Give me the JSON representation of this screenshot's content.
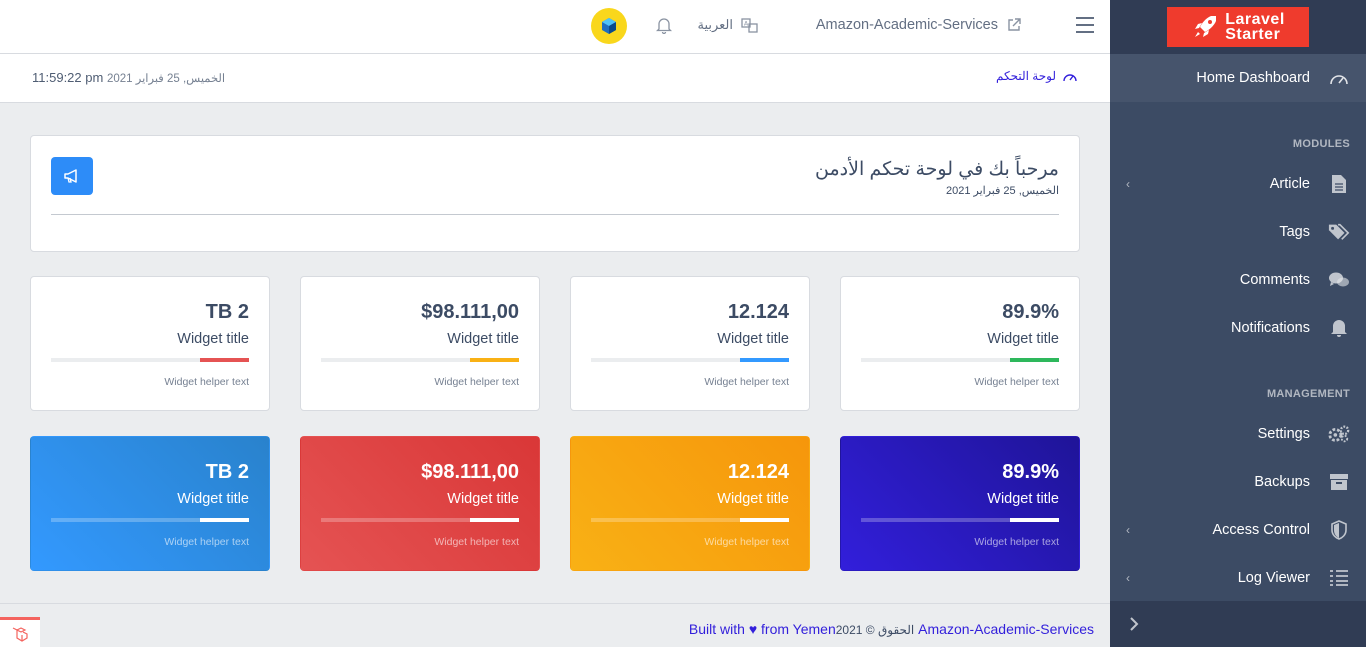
{
  "sidebar": {
    "brand": {
      "line1": "Laravel",
      "line2": "Starter"
    },
    "items": [
      {
        "label": "Home Dashboard",
        "icon": "speedometer-icon",
        "active": true
      },
      {
        "section": "MODULES"
      },
      {
        "label": "Article",
        "icon": "file-icon",
        "has_children": true
      },
      {
        "label": "Tags",
        "icon": "tags-icon"
      },
      {
        "label": "Comments",
        "icon": "comments-icon"
      },
      {
        "label": "Notifications",
        "icon": "bell-icon"
      },
      {
        "section": "MANAGEMENT"
      },
      {
        "label": "Settings",
        "icon": "gears-icon"
      },
      {
        "label": "Backups",
        "icon": "archive-icon"
      },
      {
        "label": "Access Control",
        "icon": "shield-icon",
        "has_children": true
      },
      {
        "label": "Log Viewer",
        "icon": "list-icon",
        "has_children": true
      }
    ],
    "modules_label": "MODULES",
    "management_label": "MANAGEMENT",
    "home": "Home Dashboard",
    "article": "Article",
    "tags": "Tags",
    "comments": "Comments",
    "notifications": "Notifications",
    "settings": "Settings",
    "backups": "Backups",
    "access_control": "Access Control",
    "log_viewer": "Log Viewer"
  },
  "header": {
    "app_name": "Amazon-Academic-Services",
    "language": "العربية"
  },
  "subheader": {
    "breadcrumb": "لوحة التحكم",
    "date_ar": "الخميس, 25 فبراير 2021",
    "time": "11:59:22 pm"
  },
  "welcome": {
    "title": "مرحباً بك في لوحة تحكم الأدمن",
    "date": "الخميس, 25 فبراير 2021"
  },
  "widgets_light": [
    {
      "value": "89.9%",
      "title": "Widget title",
      "helper": "Widget helper text",
      "color": "#2eb85c",
      "progress": 25
    },
    {
      "value": "12.124",
      "title": "Widget title",
      "helper": "Widget helper text",
      "color": "#3399ff",
      "progress": 25
    },
    {
      "value": "$98.111,00",
      "title": "Widget title",
      "helper": "Widget helper text",
      "color": "#f9b115",
      "progress": 25
    },
    {
      "value": "TB 2",
      "title": "Widget title",
      "helper": "Widget helper text",
      "color": "#e55353",
      "progress": 25
    }
  ],
  "widgets_dark": [
    {
      "value": "89.9%",
      "title": "Widget title",
      "helper": "Widget helper text",
      "bg": "linear-gradient(45deg,#321fdb,#1f1498)",
      "progress": 25
    },
    {
      "value": "12.124",
      "title": "Widget title",
      "helper": "Widget helper text",
      "bg": "linear-gradient(45deg,#f9b115,#f6960b)",
      "progress": 25
    },
    {
      "value": "$98.111,00",
      "title": "Widget title",
      "helper": "Widget helper text",
      "bg": "linear-gradient(45deg,#e55353,#d93737)",
      "progress": 25
    },
    {
      "value": "TB 2",
      "title": "Widget title",
      "helper": "Widget helper text",
      "bg": "linear-gradient(45deg,#39f,#2982cc)",
      "progress": 25
    }
  ],
  "footer": {
    "app_name": "Amazon-Academic-Services",
    "rights": "الحقوق © 2021",
    "built_with": "Built with",
    "heart": "♥",
    "from": "from Yemen"
  }
}
